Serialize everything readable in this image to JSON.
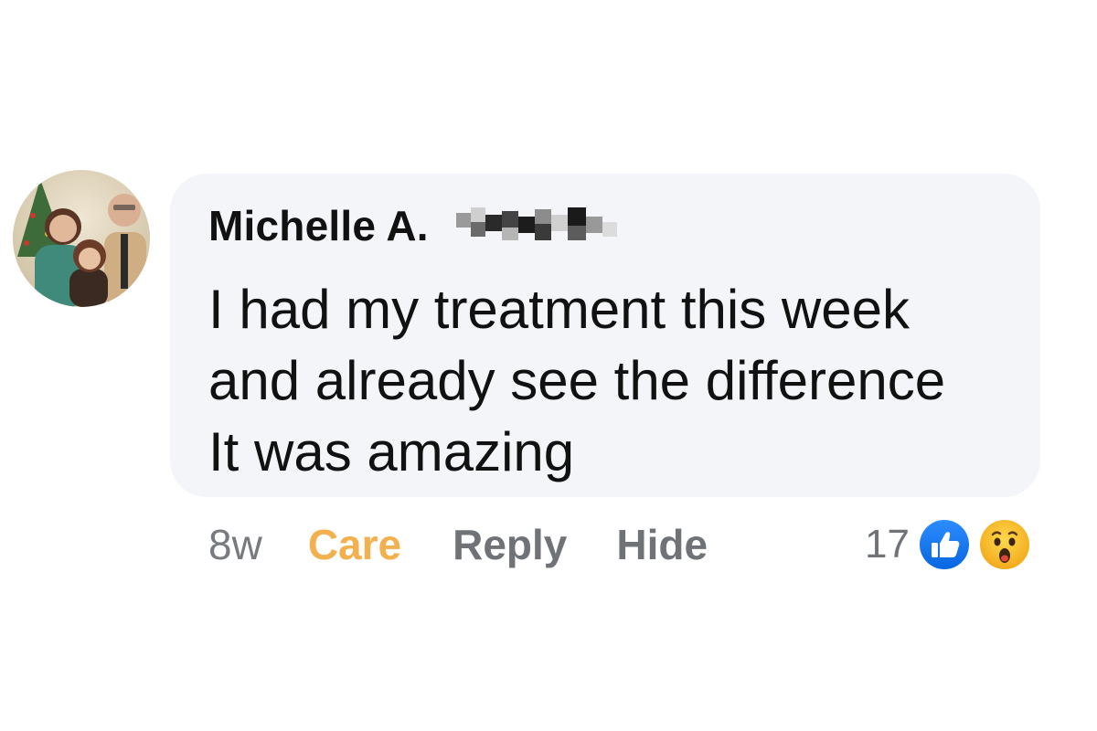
{
  "comment": {
    "author_name": "Michelle A.",
    "text": "I had my treatment this week\nand already see the difference\nIt was amazing",
    "avatar_icon": "family-photo-avatar",
    "redacted_badge_icon": "pixelated-redaction-icon"
  },
  "actions": {
    "timestamp": "8w",
    "care_label": "Care",
    "reply_label": "Reply",
    "hide_label": "Hide"
  },
  "reactions": {
    "count": "17",
    "types": [
      "like",
      "wow"
    ],
    "icons": [
      "thumbs-up-icon",
      "wow-face-icon"
    ]
  },
  "colors": {
    "bubble_background": "#f3f5f9",
    "care_active": "#f2b04e",
    "muted_text": "#6f7378",
    "like_blue": "#1877f2",
    "wow_yellow": "#f7b125"
  }
}
